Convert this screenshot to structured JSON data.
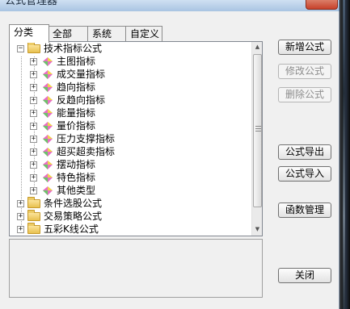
{
  "window": {
    "title": "公式管理器"
  },
  "tabs": [
    {
      "label": "分类"
    },
    {
      "label": "全部"
    },
    {
      "label": "系统"
    },
    {
      "label": "自定义"
    }
  ],
  "tree": {
    "root": {
      "label": "技术指标公式",
      "expanded": true,
      "children": [
        {
          "label": "主图指标"
        },
        {
          "label": "成交量指标"
        },
        {
          "label": "趋向指标"
        },
        {
          "label": "反趋向指标"
        },
        {
          "label": "能量指标"
        },
        {
          "label": "量价指标"
        },
        {
          "label": "压力支撑指标"
        },
        {
          "label": "超买超卖指标"
        },
        {
          "label": "摆动指标"
        },
        {
          "label": "特色指标"
        },
        {
          "label": "其他类型"
        }
      ]
    },
    "siblings": [
      {
        "label": "条件选股公式"
      },
      {
        "label": "交易策略公式"
      },
      {
        "label": "五彩K线公式"
      }
    ]
  },
  "buttons": {
    "new_formula": "新增公式",
    "edit_formula": "修改公式",
    "delete_formula": "删除公式",
    "export_formula": "公式导出",
    "import_formula": "公式导入",
    "function_manager": "函数管理",
    "close": "关闭"
  },
  "icons": {
    "folder": "folder-icon",
    "indicator": "indicator-gem-icon",
    "expand": "plus-icon",
    "collapse": "minus-icon"
  },
  "colors": {
    "dialog_bg": "#f0f0f0",
    "tree_bg": "#ffffff",
    "folder": "#f4d06b",
    "gem_pink": "#e86fc4",
    "gem_green": "#6cc36a",
    "gem_yellow": "#f0d64a"
  }
}
